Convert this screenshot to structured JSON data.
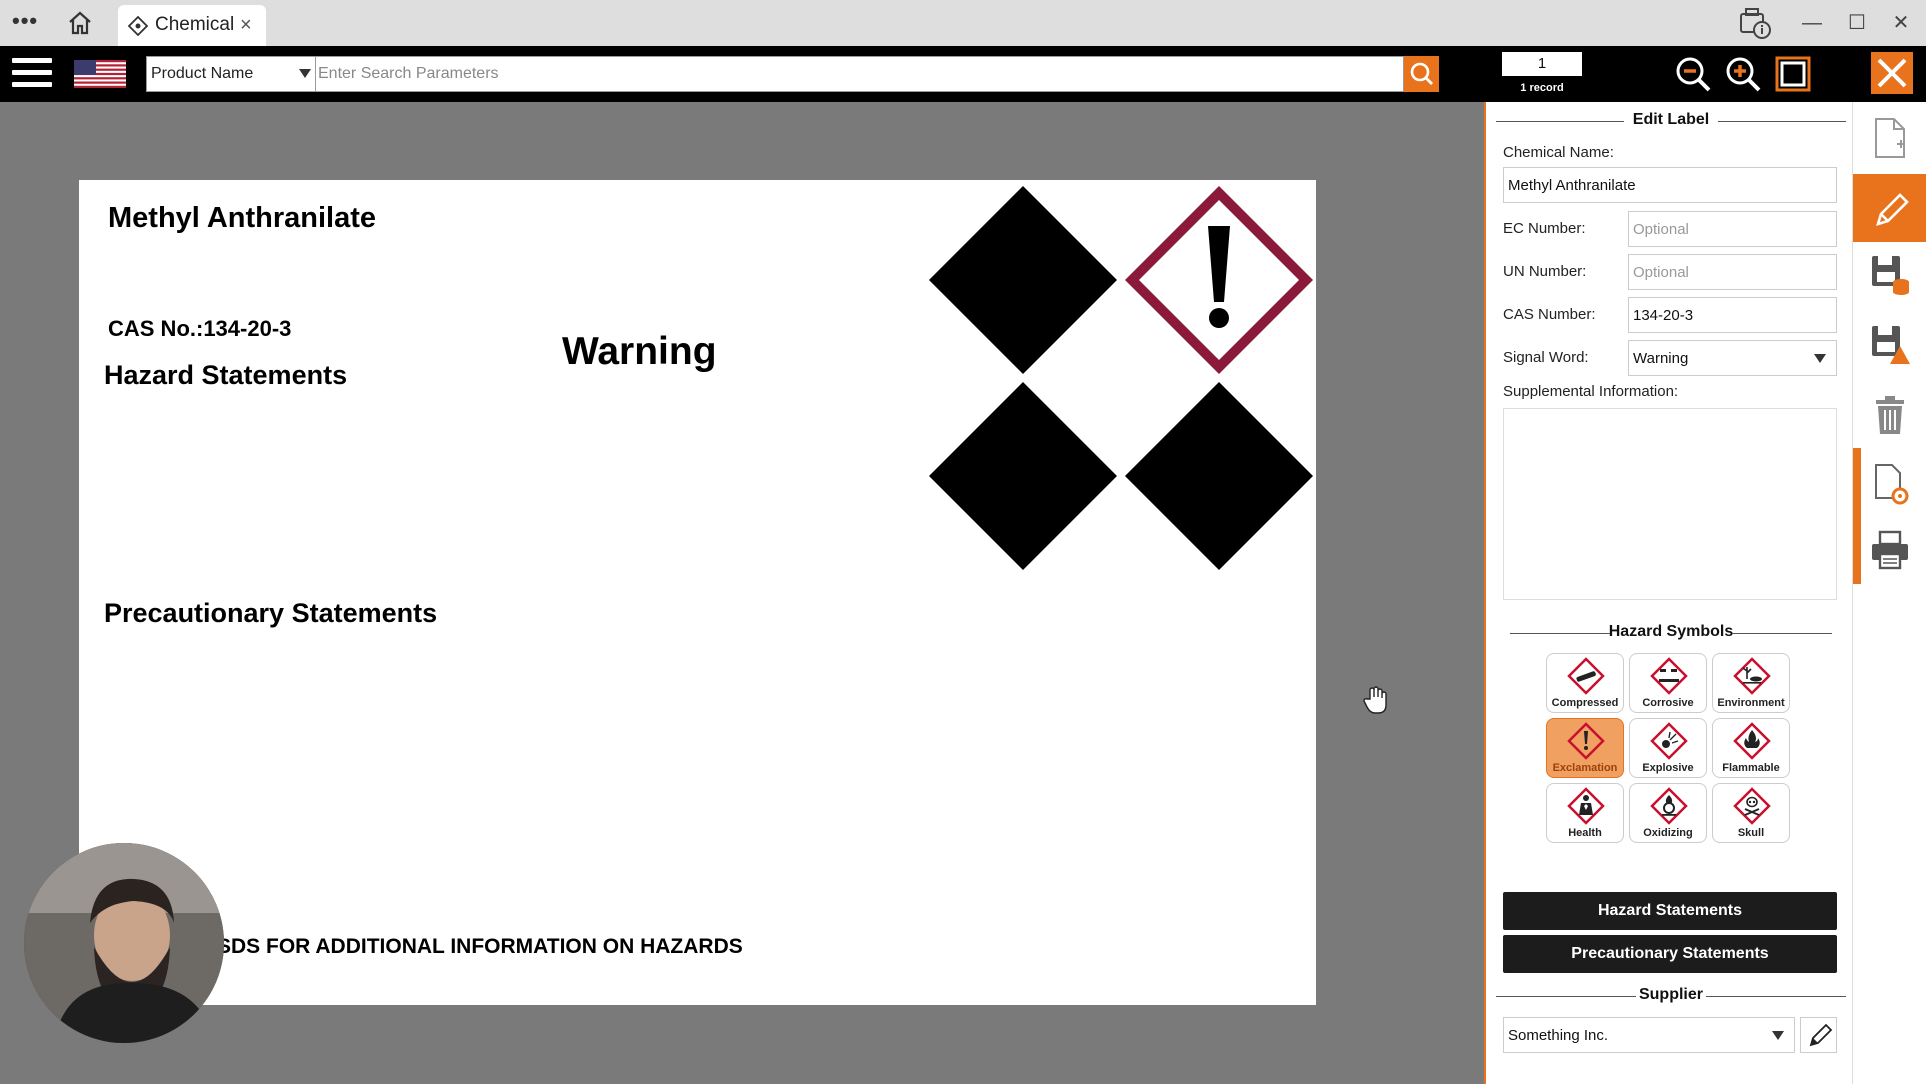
{
  "titlebar": {
    "tab_label": "Chemical",
    "tab_close": "×",
    "minimize": "—",
    "maximize": "☐",
    "close": "✕"
  },
  "toolbar": {
    "search_field_value": "Product Name",
    "search_placeholder": "Enter Search Parameters",
    "record_number": "1",
    "record_count": "1 record"
  },
  "label": {
    "chemical_name": "Methyl Anthranilate",
    "cas_line": "CAS No.:134-20-3",
    "hazard_heading": "Hazard Statements",
    "signal_word": "Warning",
    "precautionary_heading": "Precautionary Statements",
    "footer_note": "SDS FOR ADDITIONAL INFORMATION ON HAZARDS",
    "pictograms": [
      "blank",
      "exclamation",
      "blank",
      "blank"
    ],
    "pictogram_border_color": "#8b1a3a"
  },
  "panel": {
    "edit_title": "Edit Label",
    "chemical_name_label": "Chemical Name:",
    "chemical_name_value": "Methyl Anthranilate",
    "ec_label": "EC Number:",
    "ec_placeholder": "Optional",
    "un_label": "UN Number:",
    "un_placeholder": "Optional",
    "cas_label": "CAS Number:",
    "cas_value": "134-20-3",
    "signal_label": "Signal Word:",
    "signal_value": "Warning",
    "supplemental_label": "Supplemental Information:",
    "hazard_symbols_title": "Hazard Symbols",
    "symbols": [
      {
        "label": "Compressed",
        "icon": "gas-cylinder-icon",
        "active": false
      },
      {
        "label": "Corrosive",
        "icon": "corrosion-icon",
        "active": false
      },
      {
        "label": "Environment",
        "icon": "environment-icon",
        "active": false
      },
      {
        "label": "Exclamation",
        "icon": "exclamation-icon",
        "active": true
      },
      {
        "label": "Explosive",
        "icon": "exploding-bomb-icon",
        "active": false
      },
      {
        "label": "Flammable",
        "icon": "flame-icon",
        "active": false
      },
      {
        "label": "Health",
        "icon": "health-hazard-icon",
        "active": false
      },
      {
        "label": "Oxidizing",
        "icon": "flame-over-circle-icon",
        "active": false
      },
      {
        "label": "Skull",
        "icon": "skull-crossbones-icon",
        "active": false
      }
    ],
    "hazard_statements_button": "Hazard Statements",
    "precautionary_statements_button": "Precautionary Statements",
    "supplier_title": "Supplier",
    "supplier_value": "Something Inc."
  },
  "colors": {
    "accent": "#e8731c",
    "toolbar_bg": "#000000",
    "canvas_bg": "#7a7a7a",
    "ghs_red": "#c8102e"
  }
}
